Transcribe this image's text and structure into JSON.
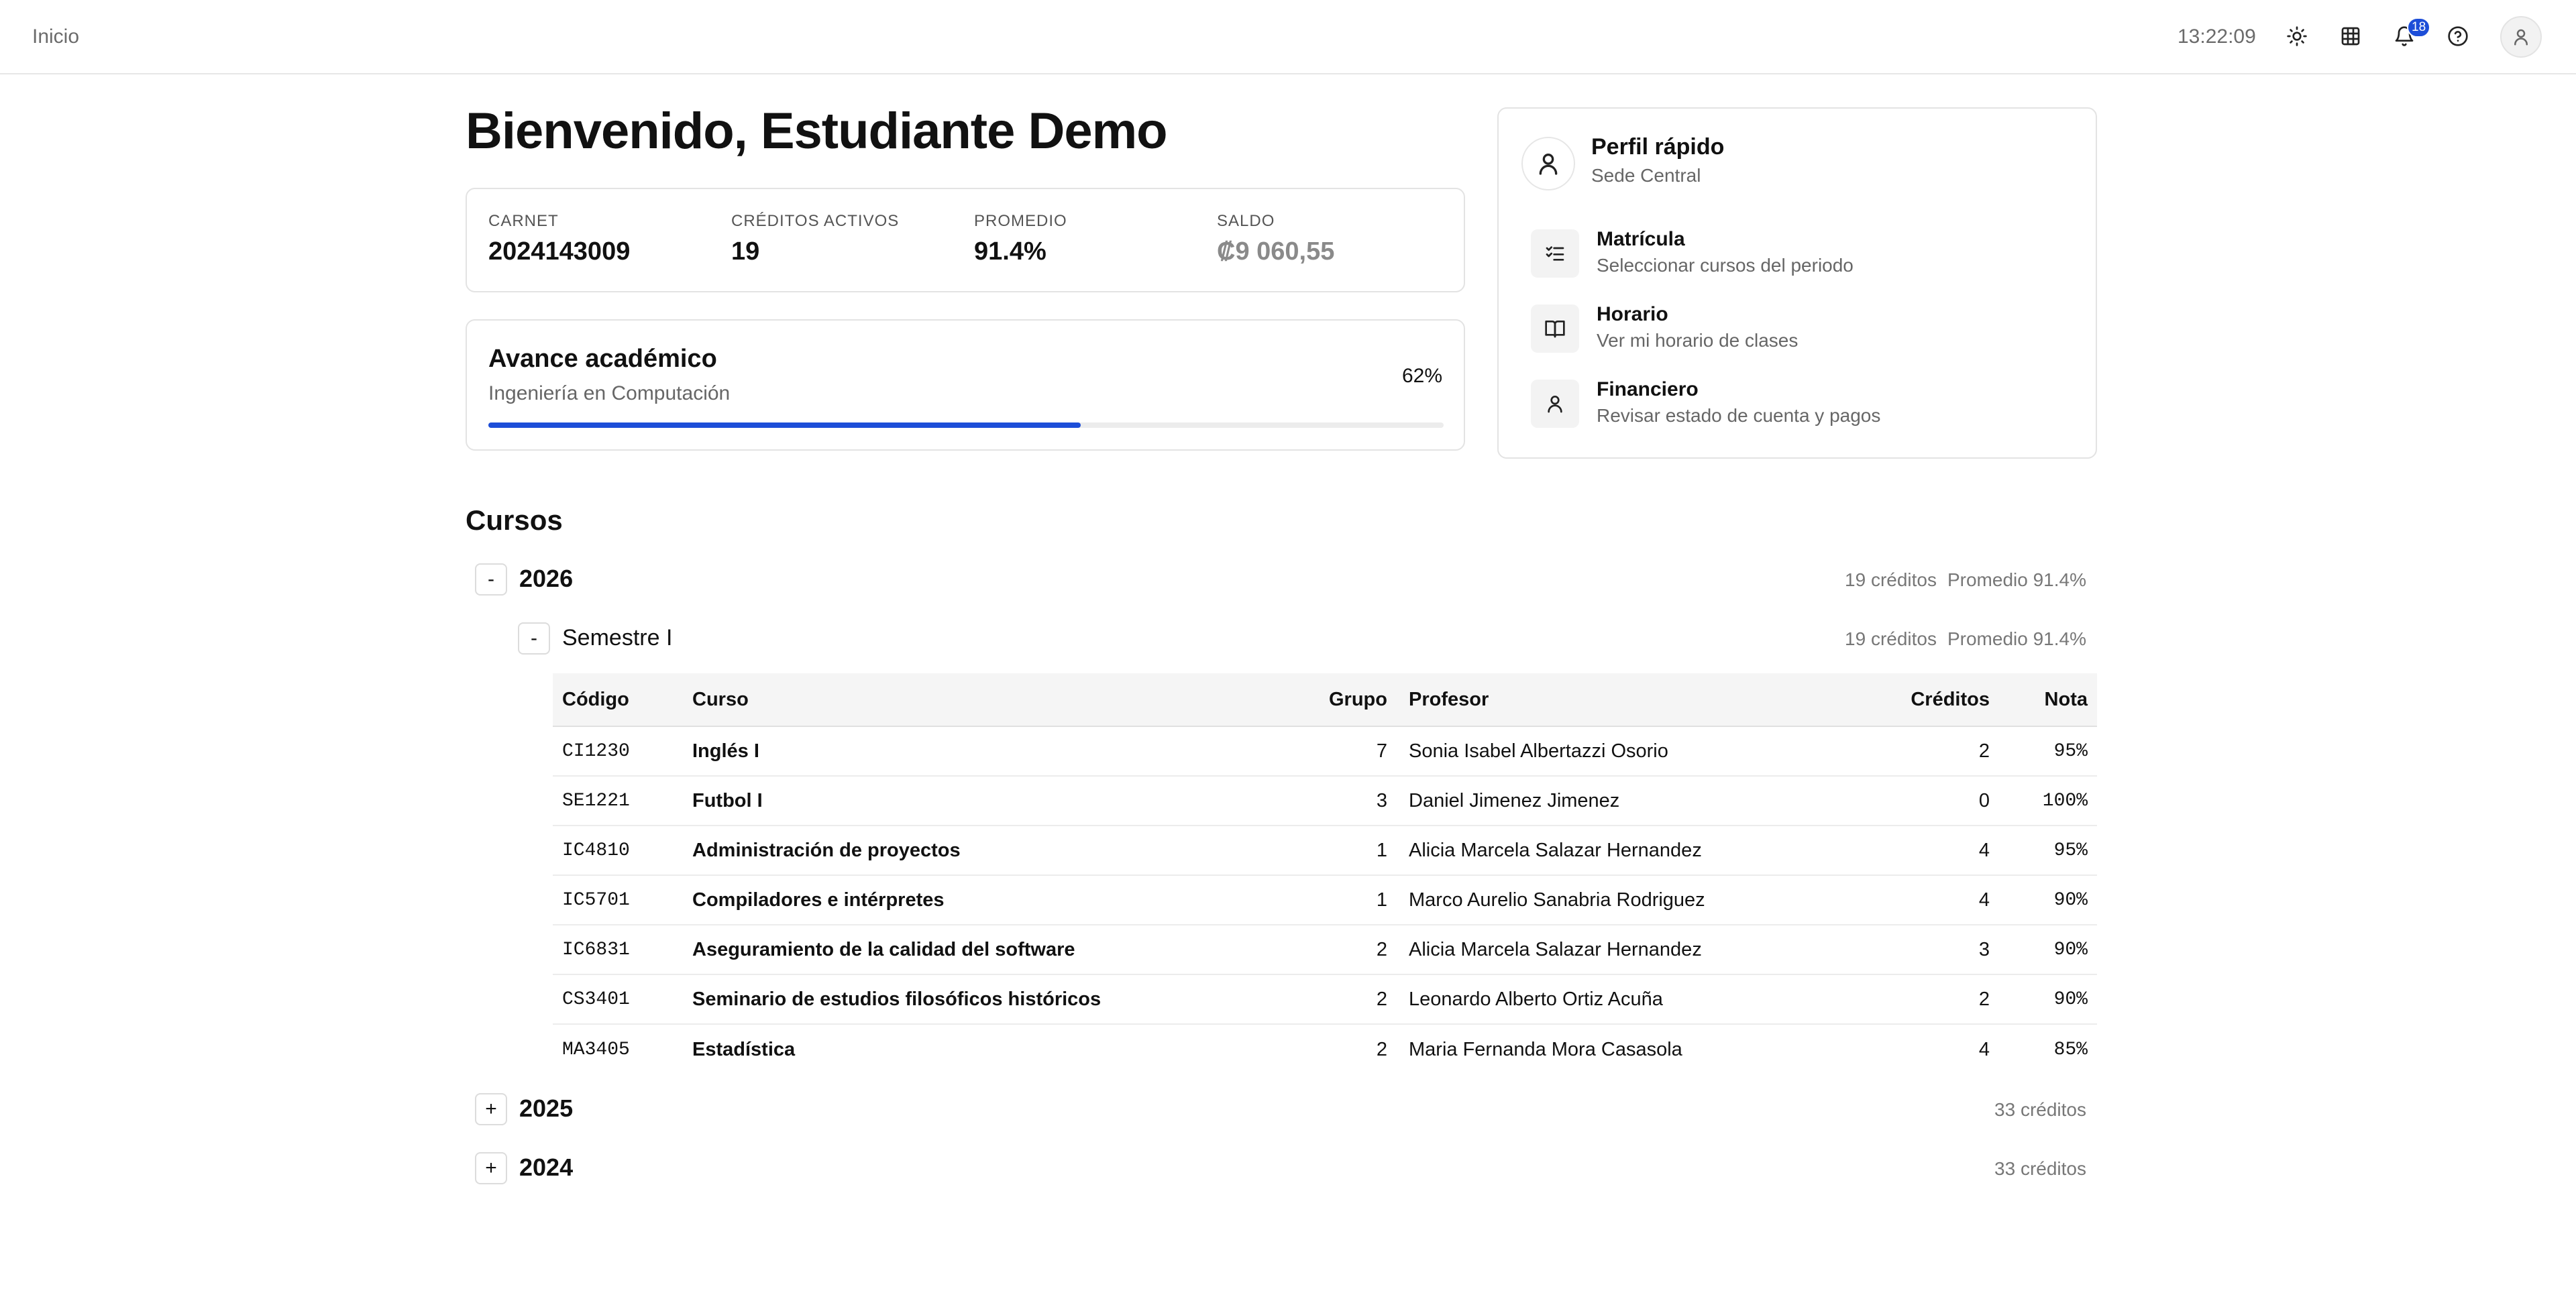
{
  "topbar": {
    "breadcrumb": "Inicio",
    "clock": "13:22:09",
    "notification_count": "18",
    "icons": [
      "sun-icon",
      "grid-icon",
      "bell-icon",
      "help-icon",
      "user-icon"
    ]
  },
  "welcome": "Bienvenido, Estudiante Demo",
  "stats": [
    {
      "label": "CARNET",
      "value": "2024143009"
    },
    {
      "label": "CRÉDITOS ACTIVOS",
      "value": "19"
    },
    {
      "label": "PROMEDIO",
      "value": "91.4%"
    },
    {
      "label": "SALDO",
      "value": "₡9 060,55"
    }
  ],
  "progress": {
    "title": "Avance académico",
    "subtitle": "Ingeniería en Computación",
    "percent_label": "62%",
    "percent": 62
  },
  "profile": {
    "title": "Perfil rápido",
    "subtitle": "Sede Central",
    "links": [
      {
        "title": "Matrícula",
        "subtitle": "Seleccionar cursos del periodo",
        "icon": "checklist-icon"
      },
      {
        "title": "Horario",
        "subtitle": "Ver mi horario de clases",
        "icon": "book-icon"
      },
      {
        "title": "Financiero",
        "subtitle": "Revisar estado de cuenta y pagos",
        "icon": "user-icon"
      }
    ]
  },
  "courses": {
    "title": "Cursos",
    "years": [
      {
        "toggle": "-",
        "label": "2026",
        "credits": "19 créditos",
        "average": "Promedio 91.4%"
      },
      {
        "toggle": "+",
        "label": "2025",
        "credits": "33 créditos",
        "average": ""
      },
      {
        "toggle": "+",
        "label": "2024",
        "credits": "33 créditos",
        "average": ""
      }
    ],
    "semester": {
      "toggle": "-",
      "label": "Semestre I",
      "credits": "19 créditos",
      "average": "Promedio 91.4%"
    },
    "table": {
      "headers": {
        "code": "Código",
        "course": "Curso",
        "group": "Grupo",
        "professor": "Profesor",
        "credits": "Créditos",
        "grade": "Nota"
      },
      "rows": [
        {
          "code": "CI1230",
          "course": "Inglés I",
          "group": "7",
          "professor": "Sonia Isabel Albertazzi Osorio",
          "credits": "2",
          "grade": "95%"
        },
        {
          "code": "SE1221",
          "course": "Futbol I",
          "group": "3",
          "professor": "Daniel Jimenez Jimenez",
          "credits": "0",
          "grade": "100%"
        },
        {
          "code": "IC4810",
          "course": "Administración de proyectos",
          "group": "1",
          "professor": "Alicia Marcela Salazar Hernandez",
          "credits": "4",
          "grade": "95%"
        },
        {
          "code": "IC5701",
          "course": "Compiladores e intérpretes",
          "group": "1",
          "professor": "Marco Aurelio Sanabria Rodriguez",
          "credits": "4",
          "grade": "90%"
        },
        {
          "code": "IC6831",
          "course": "Aseguramiento de la calidad del software",
          "group": "2",
          "professor": "Alicia Marcela Salazar Hernandez",
          "credits": "3",
          "grade": "90%"
        },
        {
          "code": "CS3401",
          "course": "Seminario de estudios filosóficos históricos",
          "group": "2",
          "professor": "Leonardo Alberto Ortiz Acuña",
          "credits": "2",
          "grade": "90%"
        },
        {
          "code": "MA3405",
          "course": "Estadística",
          "group": "2",
          "professor": "Maria Fernanda Mora Casasola",
          "credits": "4",
          "grade": "85%"
        }
      ]
    }
  },
  "colors": {
    "accent": "#1d4ed8",
    "border": "#e3e3e3",
    "muted_text": "#6b6b6b"
  }
}
